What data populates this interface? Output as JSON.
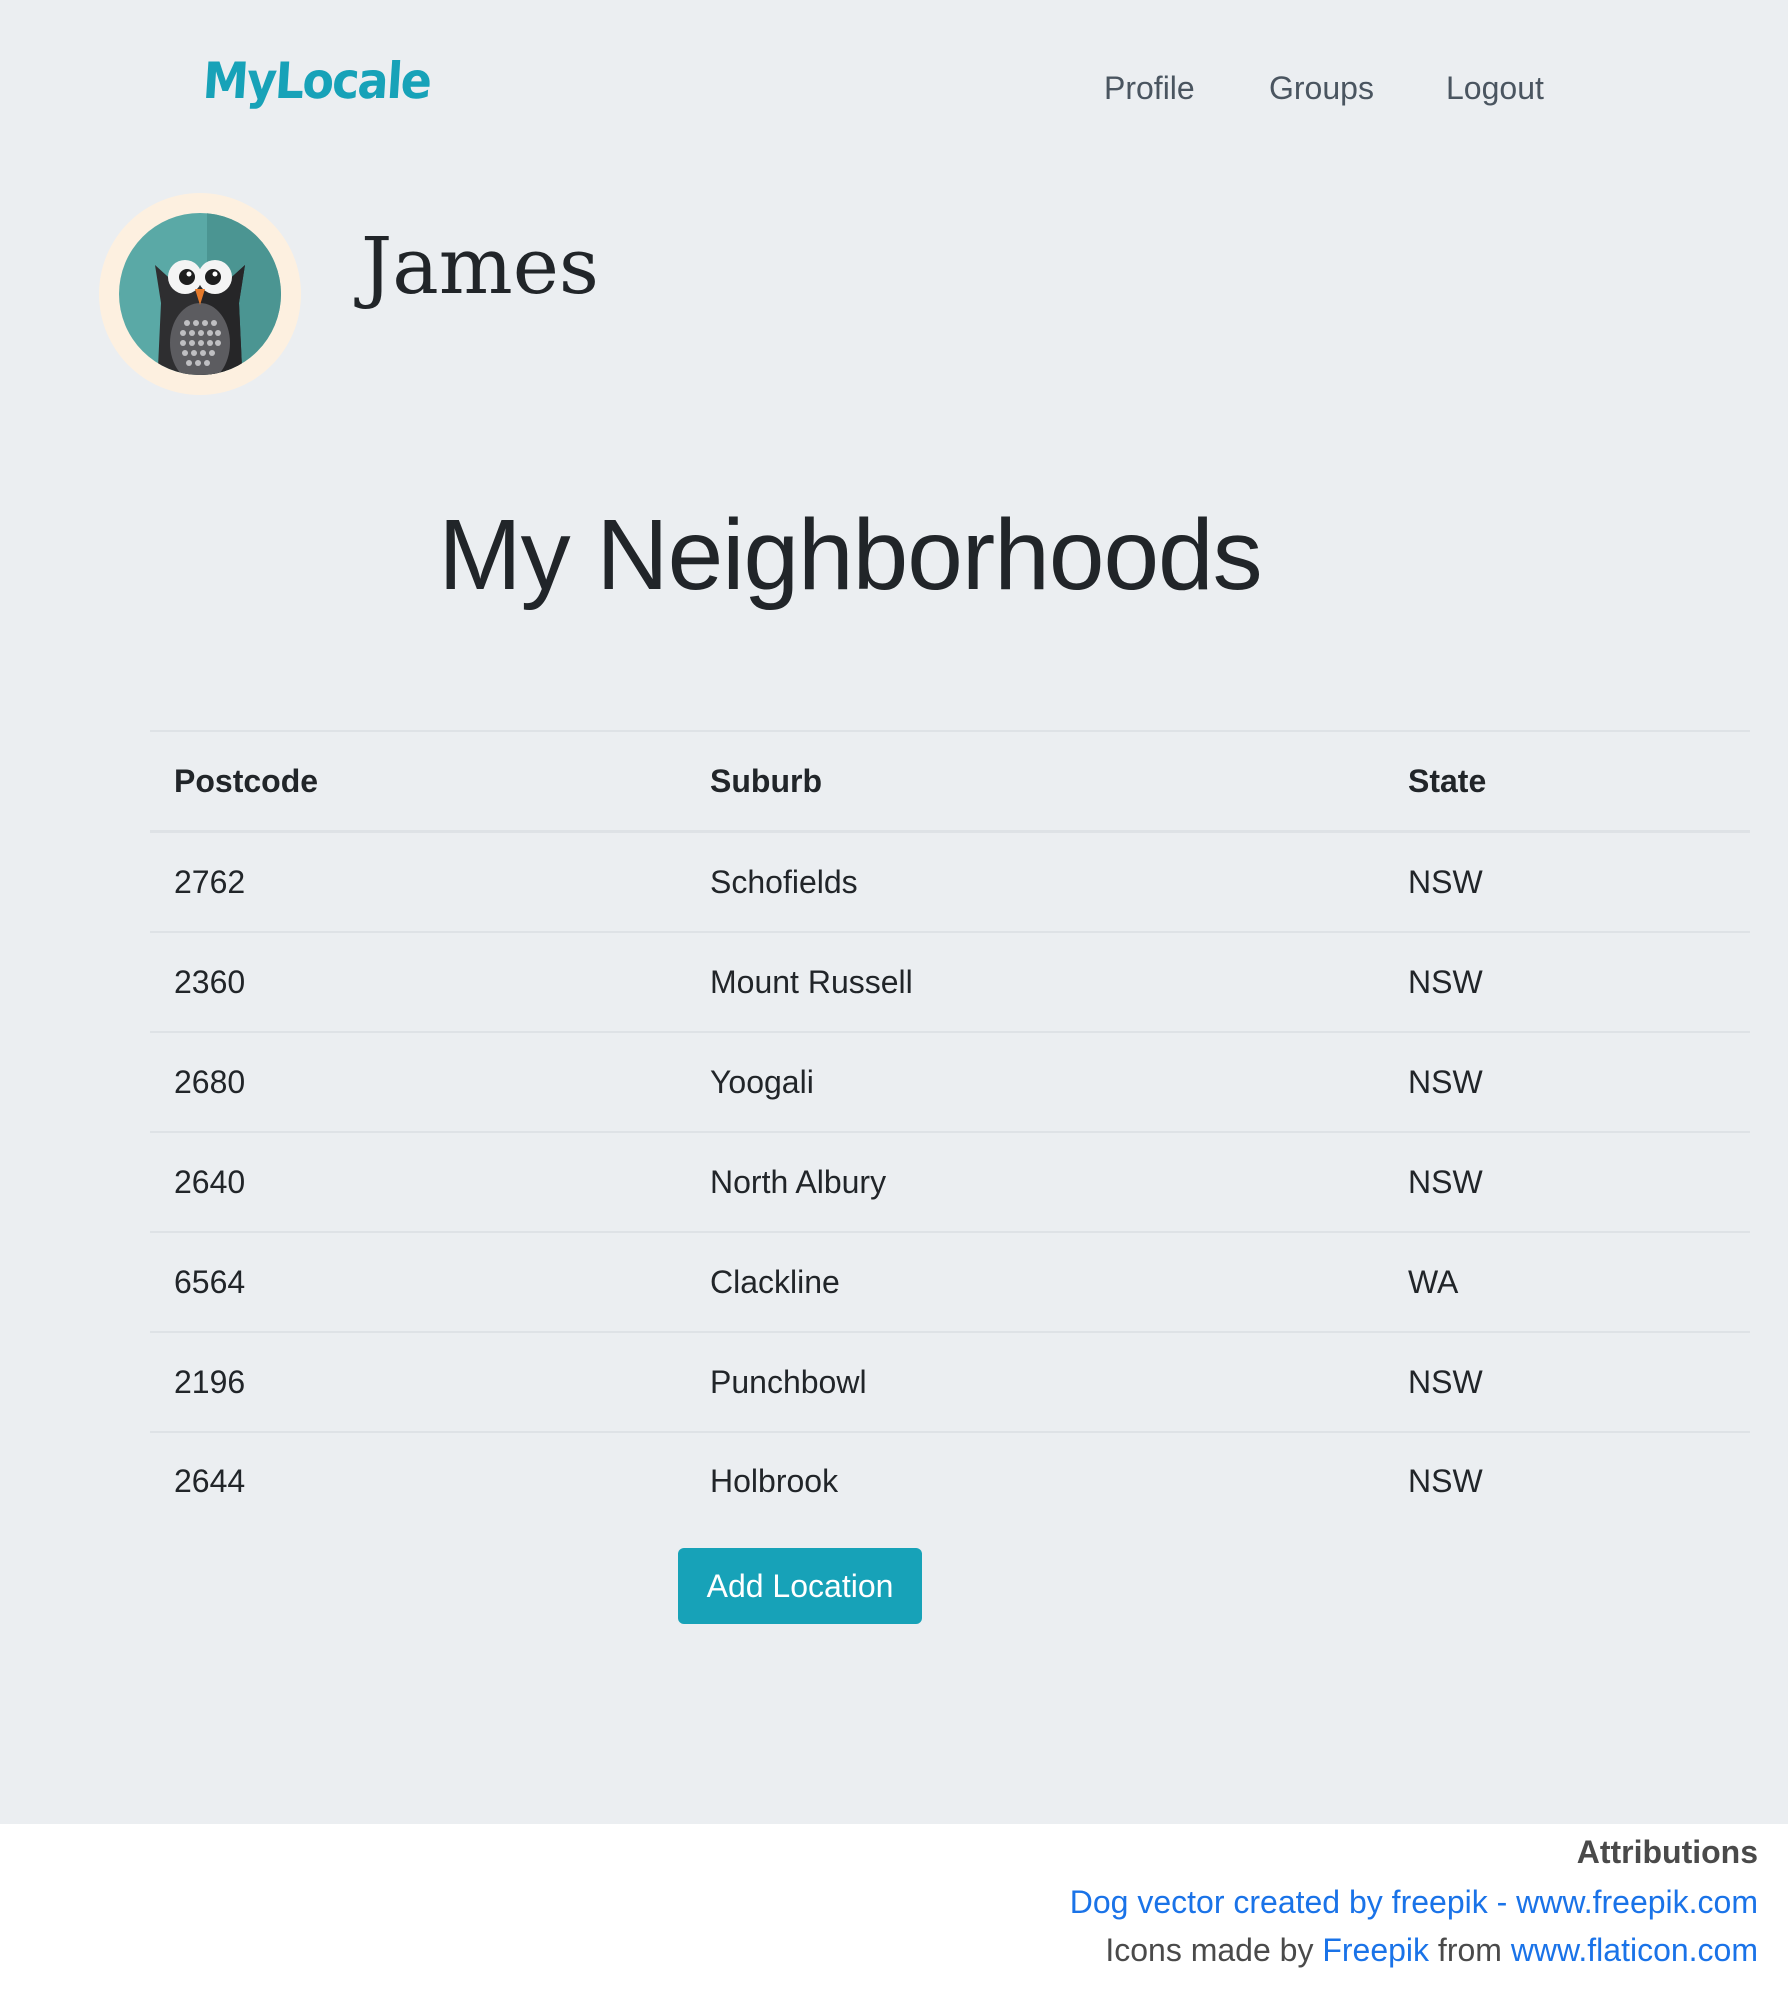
{
  "navbar": {
    "brand": "MyLocale",
    "links": {
      "profile": "Profile",
      "groups": "Groups",
      "logout": "Logout"
    }
  },
  "profile": {
    "name": "James",
    "avatar_icon": "owl-avatar"
  },
  "page": {
    "title": "My Neighborhoods"
  },
  "table": {
    "headers": {
      "postcode": "Postcode",
      "suburb": "Suburb",
      "state": "State"
    },
    "rows": [
      {
        "postcode": "2762",
        "suburb": "Schofields",
        "state": "NSW"
      },
      {
        "postcode": "2360",
        "suburb": "Mount Russell",
        "state": "NSW"
      },
      {
        "postcode": "2680",
        "suburb": "Yoogali",
        "state": "NSW"
      },
      {
        "postcode": "2640",
        "suburb": "North Albury",
        "state": "NSW"
      },
      {
        "postcode": "6564",
        "suburb": "Clackline",
        "state": "WA"
      },
      {
        "postcode": "2196",
        "suburb": "Punchbowl",
        "state": "NSW"
      },
      {
        "postcode": "2644",
        "suburb": "Holbrook",
        "state": "NSW"
      }
    ]
  },
  "actions": {
    "add_location": "Add Location"
  },
  "footer": {
    "title": "Attributions",
    "line1_link": "Dog vector created by freepik - www.freepik.com",
    "line2_prefix": "Icons made by",
    "line2_link1": "Freepik",
    "line2_middle": "from",
    "line2_link2": "www.flaticon.com"
  },
  "colors": {
    "accent": "#17a2b8",
    "background": "#ebeef1",
    "link": "#1a73e8"
  }
}
